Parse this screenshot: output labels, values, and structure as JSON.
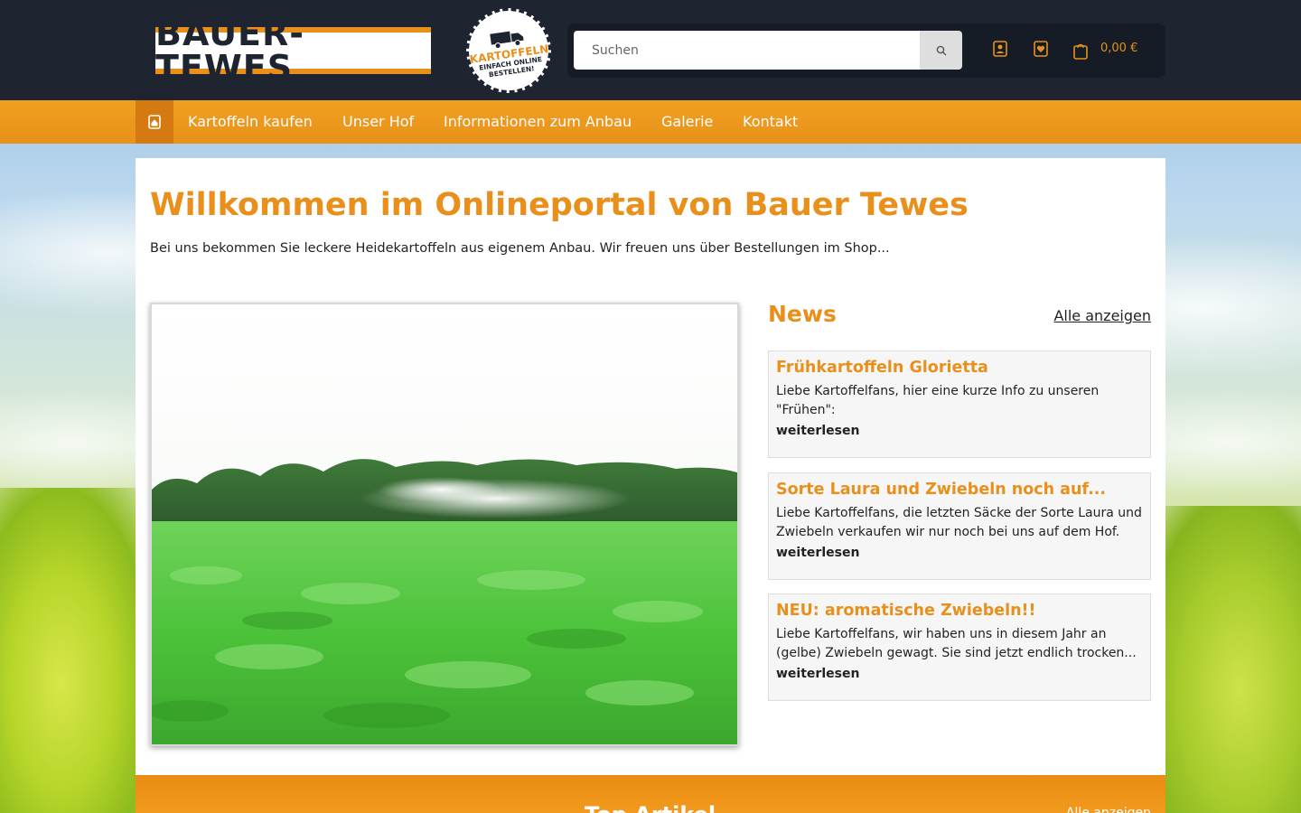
{
  "header": {
    "logo_text": "BAUER-TEWES",
    "badge": {
      "line1": "KARTOFFELN",
      "line2": "EINFACH ONLINE",
      "line3": "BESTELLEN!"
    },
    "search": {
      "placeholder": "Suchen"
    },
    "icons": [
      "user-icon",
      "heart-icon",
      "cart-icon"
    ],
    "cart_total": "0,00 €"
  },
  "nav": {
    "home_icon": "home-icon",
    "items": [
      "Kartoffeln kaufen",
      "Unser Hof",
      "Informationen zum Anbau",
      "Galerie",
      "Kontakt"
    ]
  },
  "hero": {
    "title": "Willkommen im Onlineportal von Bauer Tewes",
    "subtitle": "Bei uns bekommen Sie leckere Heidekartoffeln aus eigenem Anbau. Wir freuen uns über Bestellungen im Shop..."
  },
  "news": {
    "title": "News",
    "all_link": "Alle anzeigen",
    "items": [
      {
        "title": "Frühkartoffeln Glorietta",
        "text": "Liebe Kartoffelfans, hier eine kurze Info zu unseren \"Frühen\":",
        "more": "weiterlesen"
      },
      {
        "title": "Sorte Laura und Zwiebeln noch auf...",
        "text": "Liebe Kartoffelfans, die letzten Säcke der Sorte Laura und Zwiebeln verkaufen wir nur noch bei uns auf dem Hof.",
        "more": "weiterlesen"
      },
      {
        "title": "NEU: aromatische Zwiebeln!!",
        "text": "Liebe Kartoffelfans, wir haben uns in diesem Jahr an (gelbe) Zwiebeln gewagt. Sie sind jetzt endlich trocken...",
        "more": "weiterlesen"
      }
    ]
  },
  "top_articles": {
    "title": "Top Artikel",
    "all_link": "Alle anzeigen"
  },
  "colors": {
    "accent": "#e8901b",
    "header_bg": "#1e2530",
    "nav_bg": "#e8901b",
    "panel_bg": "#ffffff",
    "card_bg": "#f6f6f6"
  }
}
